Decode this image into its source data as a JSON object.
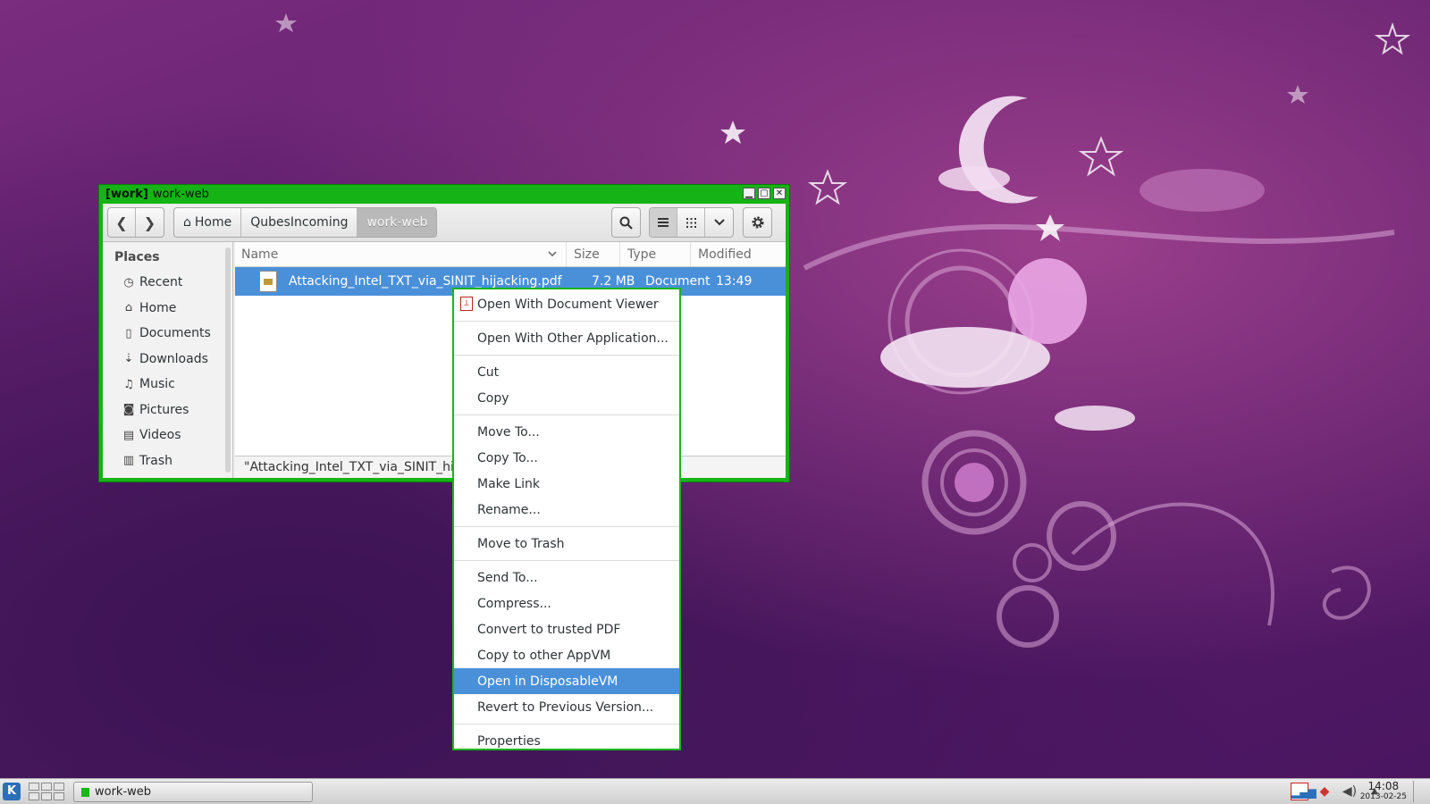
{
  "window": {
    "domain": "[work]",
    "title": "work-web",
    "controls": {
      "minimize": "▁",
      "maximize": "▢",
      "close": "✕"
    }
  },
  "toolbar": {
    "back": "❮",
    "forward": "❯",
    "breadcrumbs": [
      "Home",
      "QubesIncoming",
      "work-web"
    ],
    "icons": [
      "search-icon",
      "list-view-icon",
      "grid-view-icon",
      "chevron-down-icon",
      "gear-icon"
    ]
  },
  "sidebar": {
    "heading": "Places",
    "items": [
      {
        "label": "Recent",
        "icon": "clock-icon"
      },
      {
        "label": "Home",
        "icon": "home-icon"
      },
      {
        "label": "Documents",
        "icon": "document-icon"
      },
      {
        "label": "Downloads",
        "icon": "download-icon"
      },
      {
        "label": "Music",
        "icon": "music-icon"
      },
      {
        "label": "Pictures",
        "icon": "camera-icon"
      },
      {
        "label": "Videos",
        "icon": "film-icon"
      },
      {
        "label": "Trash",
        "icon": "trash-icon"
      }
    ]
  },
  "list": {
    "columns": {
      "name": "Name",
      "size": "Size",
      "type": "Type",
      "modified": "Modified"
    },
    "rows": [
      {
        "name": "Attacking_Intel_TXT_via_SINIT_hijacking.pdf",
        "size": "7.2 MB",
        "type": "Document",
        "modified": "13:49"
      }
    ]
  },
  "statusbar": {
    "text": "\"Attacking_Intel_TXT_via_SINIT_hijacking.pdf\" selected (7.2 MB)"
  },
  "context_menu": {
    "groups": [
      [
        "Open With Document Viewer"
      ],
      [
        "Open With Other Application..."
      ],
      [
        "Cut",
        "Copy"
      ],
      [
        "Move To...",
        "Copy To...",
        "Make Link",
        "Rename..."
      ],
      [
        "Move to Trash"
      ],
      [
        "Send To...",
        "Compress...",
        "Convert to trusted PDF",
        "Copy to other AppVM",
        "Open in DisposableVM",
        "Revert to Previous Version..."
      ],
      [
        "Properties"
      ]
    ],
    "highlighted": "Open in DisposableVM"
  },
  "taskbar": {
    "launcher": "K",
    "task_label": "work-web",
    "clock_time": "14:08",
    "clock_date": "2013-02-25"
  },
  "colors": {
    "vm_border": "#15b315",
    "selection": "#4a90d9",
    "wallpaper": "#6a2376"
  }
}
